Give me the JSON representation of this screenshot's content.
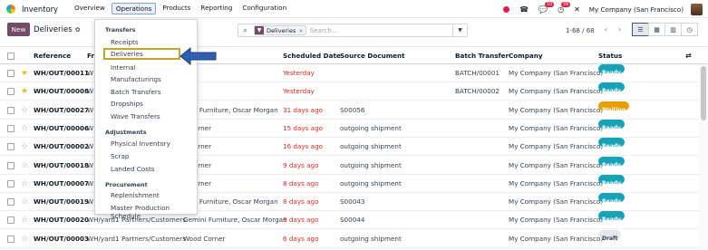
{
  "app": {
    "name": "Inventory"
  },
  "menu": [
    "Overview",
    "Operations",
    "Products",
    "Reporting",
    "Configuration"
  ],
  "systray": {
    "chat_count": "10",
    "activity_count": "39",
    "company": "My Company (San Francisco)"
  },
  "control": {
    "new_label": "New",
    "title": "Deliveries",
    "facet_label": "Deliveries",
    "search_placeholder": "Search...",
    "pager": "1-68 / 68"
  },
  "columns": {
    "reference": "Reference",
    "from": "Fro",
    "scheduled": "Scheduled Date",
    "source": "Source Document",
    "batch": "Batch Transfer",
    "company": "Company",
    "status": "Status"
  },
  "rows": [
    {
      "fav": true,
      "ref": "WH/OUT/00011",
      "from": "W",
      "to": "",
      "contact": "",
      "sched": "Yesterday",
      "src": "",
      "batch": "BATCH/00001",
      "company": "My Company (San Francisco)",
      "status": "Ready"
    },
    {
      "fav": true,
      "ref": "WH/OUT/00008",
      "from": "W",
      "to": "",
      "contact": "",
      "sched": "Yesterday",
      "src": "",
      "batch": "BATCH/00002",
      "company": "My Company (San Francisco)",
      "status": "Ready"
    },
    {
      "fav": false,
      "ref": "WH/OUT/00027",
      "from": "W",
      "to": "",
      "contact": "mini Furniture, Oscar Morgan",
      "sched": "31 days ago",
      "src": "S00056",
      "batch": "",
      "company": "My Company (San Francisco)",
      "status": "Waiting"
    },
    {
      "fav": false,
      "ref": "WH/OUT/00006",
      "from": "W",
      "to": "",
      "contact": "d Corner",
      "sched": "15 days ago",
      "src": "outgoing shipment",
      "batch": "",
      "company": "My Company (San Francisco)",
      "status": "Ready"
    },
    {
      "fav": false,
      "ref": "WH/OUT/00002",
      "from": "W",
      "to": "",
      "contact": "d Corner",
      "sched": "16 days ago",
      "src": "outgoing shipment",
      "batch": "",
      "company": "My Company (San Francisco)",
      "status": "Ready"
    },
    {
      "fav": false,
      "ref": "WH/OUT/00018",
      "from": "W",
      "to": "",
      "contact": "d Corner",
      "sched": "9 days ago",
      "src": "outgoing shipment",
      "batch": "",
      "company": "My Company (San Francisco)",
      "status": "Ready"
    },
    {
      "fav": false,
      "ref": "WH/OUT/00007",
      "from": "W",
      "to": "",
      "contact": "d Corner",
      "sched": "8 days ago",
      "src": "outgoing shipment",
      "batch": "",
      "company": "My Company (San Francisco)",
      "status": "Ready"
    },
    {
      "fav": false,
      "ref": "WH/OUT/00019",
      "from": "W",
      "to": "",
      "contact": "mini Furniture, Oscar Morgan",
      "sched": "8 days ago",
      "src": "S00043",
      "batch": "",
      "company": "My Company (San Francisco)",
      "status": "Ready"
    },
    {
      "fav": false,
      "ref": "WH/OUT/00020",
      "from": "WH/yard1",
      "to": "Partners/Customers",
      "contact": "Gemini Furniture, Oscar Morgan",
      "sched": "8 days ago",
      "src": "S00044",
      "batch": "",
      "company": "My Company (San Francisco)",
      "status": "Ready"
    },
    {
      "fav": false,
      "ref": "WH/OUT/00003",
      "from": "WH/yard1",
      "to": "Partners/Customers",
      "contact": "Wood Corner",
      "sched": "6 days ago",
      "src": "outgoing shipment",
      "batch": "",
      "company": "My Company (San Francisco)",
      "status": "Draft"
    }
  ],
  "dropdown": {
    "transfers_header": "Transfers",
    "transfers": [
      "Receipts",
      "Deliveries",
      "Internal",
      "Manufacturings",
      "Batch Transfers",
      "Dropships",
      "Wave Transfers"
    ],
    "adjustments_header": "Adjustments",
    "adjustments": [
      "Physical Inventory",
      "Scrap",
      "Landed Costs"
    ],
    "procurement_header": "Procurement",
    "procurement": [
      "Replenishment",
      "Master Production Schedule"
    ]
  },
  "colors": {
    "brand": "#714b67",
    "ready": "#17a2b8",
    "waiting": "#e5a000",
    "late": "#dc2626",
    "highlight": "#c9a227",
    "arrow": "#2f5fb3"
  }
}
